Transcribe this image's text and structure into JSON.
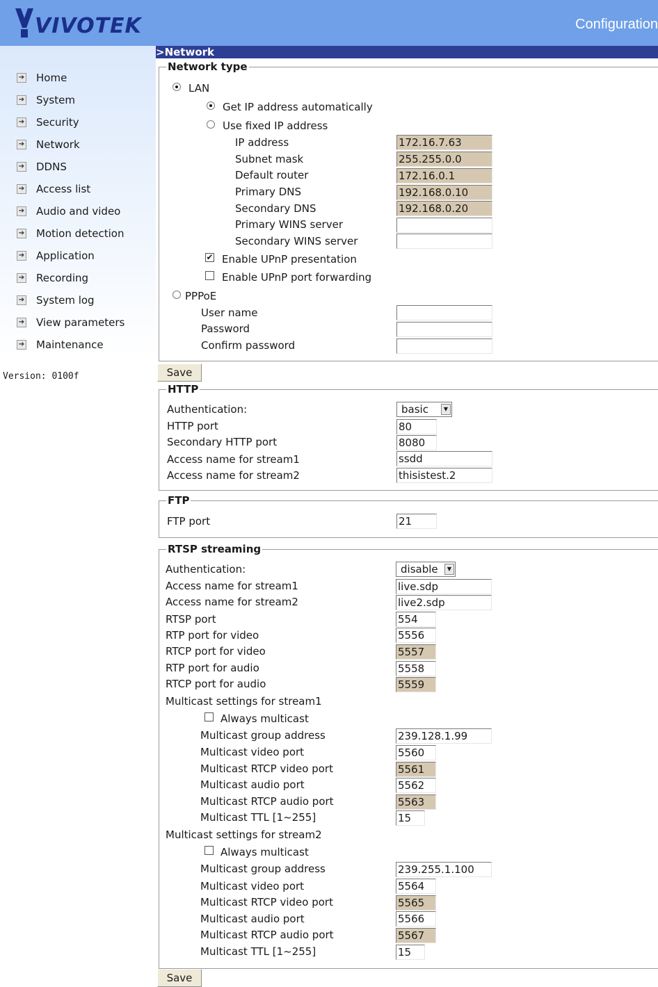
{
  "header": {
    "brand": "VIVOTEK",
    "title": "Configuration"
  },
  "sidebar": {
    "items": [
      {
        "label": "Home"
      },
      {
        "label": "System"
      },
      {
        "label": "Security"
      },
      {
        "label": "Network"
      },
      {
        "label": "DDNS"
      },
      {
        "label": "Access list"
      },
      {
        "label": "Audio and video"
      },
      {
        "label": "Motion detection"
      },
      {
        "label": "Application"
      },
      {
        "label": "Recording"
      },
      {
        "label": "System log"
      },
      {
        "label": "View parameters"
      },
      {
        "label": "Maintenance"
      }
    ],
    "version": "Version: 0100f"
  },
  "section_title": ">Network",
  "network_type": {
    "legend": "Network type",
    "lan_label": "LAN",
    "get_auto_label": "Get IP address automatically",
    "use_fixed_label": "Use fixed IP address",
    "ip_label": "IP address",
    "ip_value": "172.16.7.63",
    "subnet_label": "Subnet mask",
    "subnet_value": "255.255.0.0",
    "router_label": "Default router",
    "router_value": "172.16.0.1",
    "dns1_label": "Primary DNS",
    "dns1_value": "192.168.0.10",
    "dns2_label": "Secondary DNS",
    "dns2_value": "192.168.0.20",
    "wins1_label": "Primary WINS server",
    "wins1_value": "",
    "wins2_label": "Secondary WINS server",
    "wins2_value": "",
    "upnp_presentation_label": "Enable UPnP presentation",
    "upnp_forwarding_label": "Enable UPnP port forwarding",
    "pppoe_label": "PPPoE",
    "username_label": "User name",
    "password_label": "Password",
    "confirm_label": "Confirm password"
  },
  "save_label": "Save",
  "http": {
    "legend": "HTTP",
    "auth_label": "Authentication:",
    "auth_value": "basic",
    "port_label": "HTTP port",
    "port_value": "80",
    "sec_port_label": "Secondary HTTP port",
    "sec_port_value": "8080",
    "stream1_label": "Access name for stream1",
    "stream1_value": "ssdd",
    "stream2_label": "Access name for stream2",
    "stream2_value": "thisistest.2"
  },
  "ftp": {
    "legend": "FTP",
    "port_label": "FTP port",
    "port_value": "21"
  },
  "rtsp": {
    "legend": "RTSP streaming",
    "auth_label": "Authentication:",
    "auth_value": "disable",
    "stream1_label": "Access name for stream1",
    "stream1_value": "live.sdp",
    "stream2_label": "Access name for stream2",
    "stream2_value": "live2.sdp",
    "rtsp_port_label": "RTSP port",
    "rtsp_port_value": "554",
    "rtp_video_label": "RTP port for video",
    "rtp_video_value": "5556",
    "rtcp_video_label": "RTCP port for video",
    "rtcp_video_value": "5557",
    "rtp_audio_label": "RTP port for audio",
    "rtp_audio_value": "5558",
    "rtcp_audio_label": "RTCP port for audio",
    "rtcp_audio_value": "5559",
    "mc1_label": "Multicast settings for stream1",
    "mc1_always_label": "Always multicast",
    "mc1_group_label": "Multicast group address",
    "mc1_group_value": "239.128.1.99",
    "mc1_video_label": "Multicast video port",
    "mc1_video_value": "5560",
    "mc1_rtcp_video_label": "Multicast RTCP video port",
    "mc1_rtcp_video_value": "5561",
    "mc1_audio_label": "Multicast audio port",
    "mc1_audio_value": "5562",
    "mc1_rtcp_audio_label": "Multicast RTCP audio port",
    "mc1_rtcp_audio_value": "5563",
    "mc1_ttl_label": "Multicast TTL [1~255]",
    "mc1_ttl_value": "15",
    "mc2_label": "Multicast settings for stream2",
    "mc2_always_label": "Always multicast",
    "mc2_group_label": "Multicast group address",
    "mc2_group_value": "239.255.1.100",
    "mc2_video_label": "Multicast video port",
    "mc2_video_value": "5564",
    "mc2_rtcp_video_label": "Multicast RTCP video port",
    "mc2_rtcp_video_value": "5565",
    "mc2_audio_label": "Multicast audio port",
    "mc2_audio_value": "5566",
    "mc2_rtcp_audio_label": "Multicast RTCP audio port",
    "mc2_rtcp_audio_value": "5567",
    "mc2_ttl_label": "Multicast TTL [1~255]",
    "mc2_ttl_value": "15"
  }
}
